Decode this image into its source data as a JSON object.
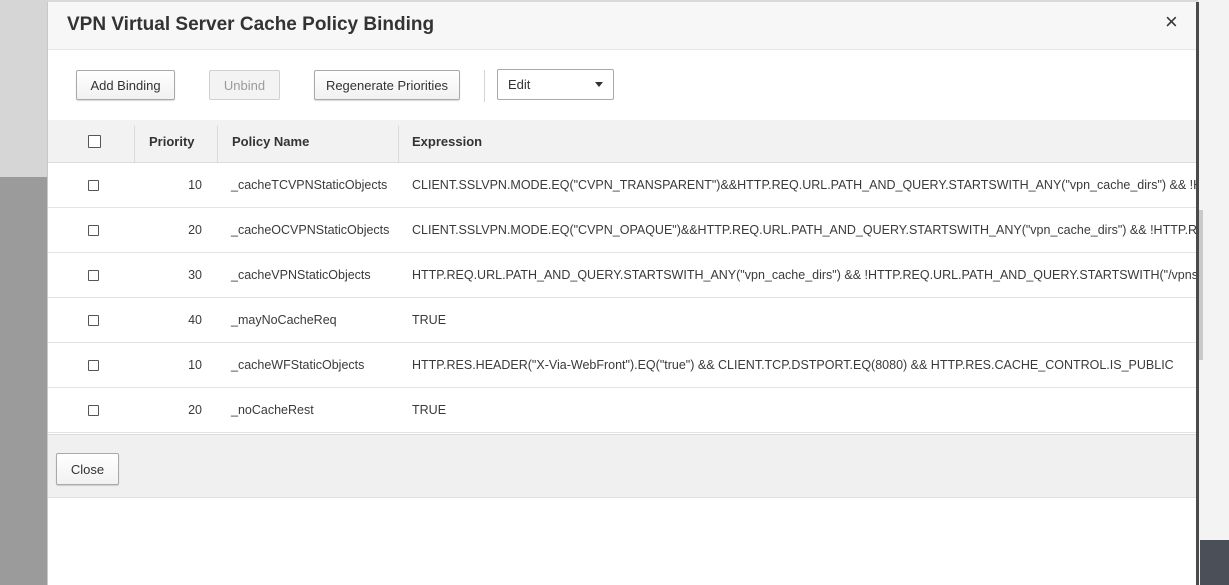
{
  "dialog": {
    "title": "VPN Virtual Server Cache Policy Binding",
    "close_glyph": "×"
  },
  "toolbar": {
    "add_binding_label": "Add Binding",
    "unbind_label": "Unbind",
    "regenerate_label": "Regenerate Priorities",
    "edit_select_value": "Edit"
  },
  "table": {
    "columns": {
      "priority": "Priority",
      "policy_name": "Policy Name",
      "expression": "Expression"
    },
    "rows": [
      {
        "priority": "10",
        "policy_name": "_cacheTCVPNStaticObjects",
        "expression": "CLIENT.SSLVPN.MODE.EQ(\"CVPN_TRANSPARENT\")&&HTTP.REQ.URL.PATH_AND_QUERY.STARTSWITH_ANY(\"vpn_cache_dirs\") && !HTTP.REQ.URL.PATH_AND_QUERY.STARTSWITH(\"/vpns/portal/\")"
      },
      {
        "priority": "20",
        "policy_name": "_cacheOCVPNStaticObjects",
        "expression": "CLIENT.SSLVPN.MODE.EQ(\"CVPN_OPAQUE\")&&HTTP.REQ.URL.PATH_AND_QUERY.STARTSWITH_ANY(\"vpn_cache_dirs\") && !HTTP.REQ.URL.PATH_AND_QUERY.STARTSWITH(\"/vpns/portal/\")"
      },
      {
        "priority": "30",
        "policy_name": "_cacheVPNStaticObjects",
        "expression": "HTTP.REQ.URL.PATH_AND_QUERY.STARTSWITH_ANY(\"vpn_cache_dirs\") && !HTTP.REQ.URL.PATH_AND_QUERY.STARTSWITH(\"/vpns/portal/\") && !HTTP.REQ.URL.PATH_AND_QUERY.STARTSWITH(\"/vpns/portal/\")"
      },
      {
        "priority": "40",
        "policy_name": "_mayNoCacheReq",
        "expression": "TRUE"
      },
      {
        "priority": "10",
        "policy_name": "_cacheWFStaticObjects",
        "expression": "HTTP.RES.HEADER(\"X-Via-WebFront\").EQ(\"true\") && CLIENT.TCP.DSTPORT.EQ(8080) && HTTP.RES.CACHE_CONTROL.IS_PUBLIC"
      },
      {
        "priority": "20",
        "policy_name": "_noCacheRest",
        "expression": "TRUE"
      }
    ]
  },
  "footer": {
    "close_label": "Close"
  }
}
